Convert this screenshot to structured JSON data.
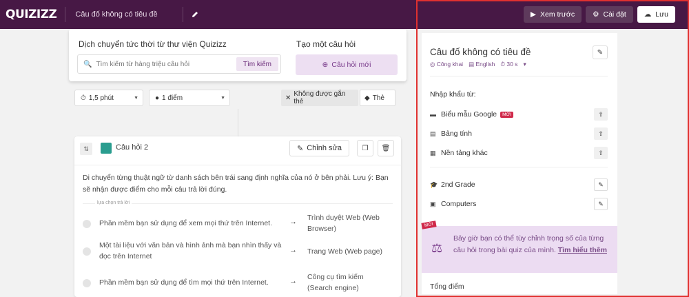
{
  "topbar": {
    "logo": "QUIZIZZ",
    "quiz_title": "Câu đố không có tiêu đề",
    "preview_label": "Xem trước",
    "settings_label": "Cài đặt",
    "save_label": "Lưu"
  },
  "library": {
    "heading": "Dịch chuyển tức thời từ thư viện Quizizz",
    "search_placeholder": "Tìm kiếm từ hàng triệu câu hỏi",
    "search_button": "Tìm kiếm"
  },
  "create": {
    "heading": "Tạo một câu hỏi",
    "new_question_button": "Câu hỏi mới"
  },
  "question_options": {
    "time": "1,5 phút",
    "points": "1 điểm",
    "tag_filter": "Không được gắn thẻ",
    "tag_label": "Thẻ"
  },
  "question": {
    "label": "Câu hỏi 2",
    "edit_button": "Chỉnh sửa",
    "text": "Di chuyển từng thuật ngữ từ danh sách bên trái sang định nghĩa của nó ở bên phải. Lưu ý: Bạn sẽ nhận được điểm cho mỗi câu trả lời đúng.",
    "choices_label": "lựa chọn trả lời",
    "pairs": [
      {
        "term": "Phần mềm bạn sử dụng để xem mọi thứ trên Internet.",
        "definition": "Trình duyệt Web (Web Browser)"
      },
      {
        "term": "Một tài liệu với văn bản và hình ảnh mà bạn nhìn thấy và đọc trên Internet",
        "definition": "Trang Web (Web page)"
      },
      {
        "term": "Phần mềm bạn sử dụng để tìm mọi thứ trên Internet.",
        "definition": "Công cụ tìm kiếm (Search engine)"
      }
    ]
  },
  "sidebar": {
    "title": "Câu đố không có tiêu đề",
    "visibility": "Công khai",
    "language": "English",
    "time": "30 s",
    "import_heading": "Nhập khẩu từ:",
    "imports": [
      {
        "label": "Biểu mẫu Google",
        "badge": "MỚI"
      },
      {
        "label": "Bảng tính",
        "badge": ""
      },
      {
        "label": "Nền tảng khác",
        "badge": ""
      }
    ],
    "grade": "2nd Grade",
    "subject": "Computers",
    "promo_badge": "MỚI",
    "promo_text": "Bây giờ bạn có thể tùy chỉnh trọng số của từng câu hỏi trong bài quiz của mình. ",
    "promo_link": "Tìm hiểu thêm",
    "total_label": "Tổng điểm"
  },
  "colors": {
    "topbar": "#471845",
    "accent": "#7a3d8c",
    "highlight_border": "#e0312f",
    "badge": "#d0294a"
  }
}
